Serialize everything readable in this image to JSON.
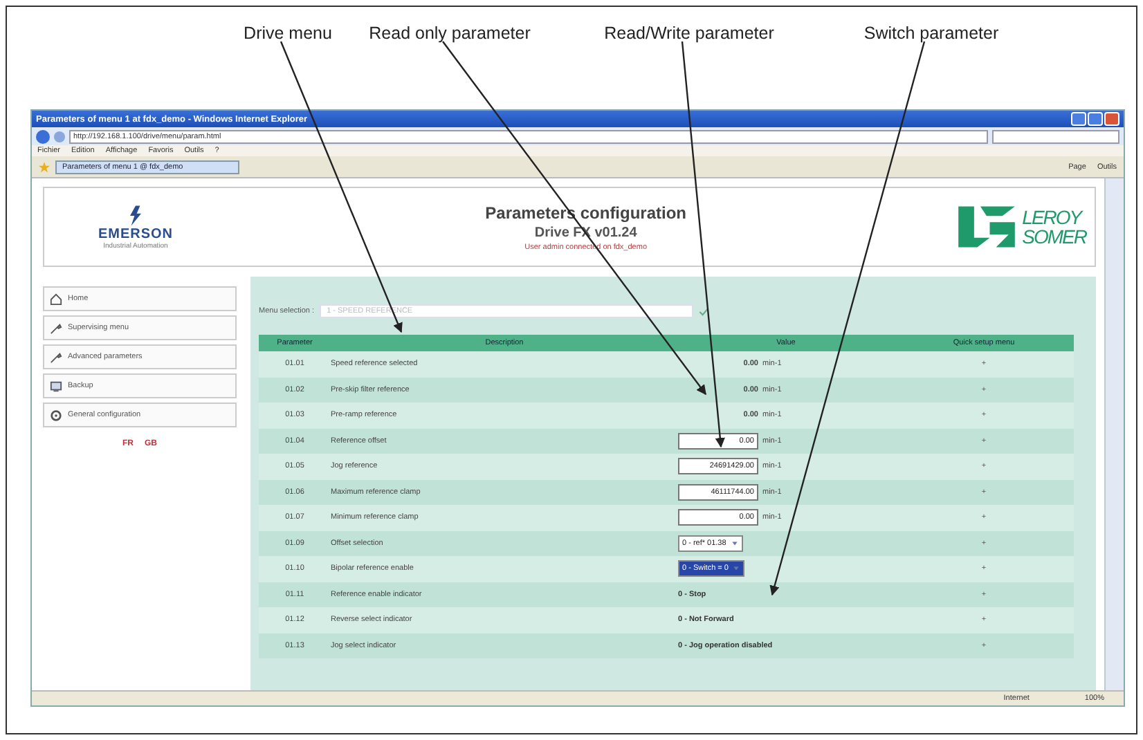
{
  "callouts": [
    "Drive menu",
    "Read only parameter",
    "Read/Write parameter",
    "Switch parameter"
  ],
  "browser": {
    "title": "Parameters of menu 1 at fdx_demo - Windows Internet Explorer",
    "address": "http://192.168.1.100/drive/menu/param.html",
    "menu": [
      "Fichier",
      "Edition",
      "Affichage",
      "Favoris",
      "Outils",
      "?"
    ],
    "tab": "Parameters of menu 1 @ fdx_demo",
    "tools": [
      "Page",
      "Outils"
    ],
    "status": [
      "Internet",
      "100%"
    ]
  },
  "header": {
    "brand_left": "EMERSON",
    "brand_left_sub": "Industrial Automation",
    "title": "Parameters configuration",
    "subtitle": "Drive FX v01.24",
    "user": "User admin connected on fdx_demo",
    "brand_right": [
      "LEROY",
      "SOMER"
    ]
  },
  "sidebar": [
    {
      "label": "Home"
    },
    {
      "label": "Supervising menu"
    },
    {
      "label": "Advanced parameters"
    },
    {
      "label": "Backup"
    },
    {
      "label": "General configuration"
    }
  ],
  "languages": [
    "FR",
    "GB"
  ],
  "menu_selection": {
    "label": "Menu selection :",
    "value": "1 - SPEED REFERENCE"
  },
  "table": {
    "columns": [
      "Parameter",
      "Description",
      "Value",
      "Quick setup menu"
    ],
    "rows": [
      {
        "param": "01.01",
        "description": "Speed reference selected",
        "kind": "readonly",
        "value": "0.00",
        "unit": "min-1",
        "quick": "+"
      },
      {
        "param": "01.02",
        "description": "Pre-skip filter reference",
        "kind": "readonly",
        "value": "0.00",
        "unit": "min-1",
        "quick": "+"
      },
      {
        "param": "01.03",
        "description": "Pre-ramp reference",
        "kind": "readonly",
        "value": "0.00",
        "unit": "min-1",
        "quick": "+"
      },
      {
        "param": "01.04",
        "description": "Reference offset",
        "kind": "input",
        "value": "0.00",
        "unit": "min-1",
        "quick": "+"
      },
      {
        "param": "01.05",
        "description": "Jog reference",
        "kind": "input",
        "value": "24691429.00",
        "unit": "min-1",
        "quick": "+"
      },
      {
        "param": "01.06",
        "description": "Maximum reference clamp",
        "kind": "input",
        "value": "46111744.00",
        "unit": "min-1",
        "quick": "+"
      },
      {
        "param": "01.07",
        "description": "Minimum reference clamp",
        "kind": "input",
        "value": "0.00",
        "unit": "min-1",
        "quick": "+"
      },
      {
        "param": "01.09",
        "description": "Offset selection",
        "kind": "select",
        "value": "0 - ref* 01.38",
        "selected": false,
        "quick": "+"
      },
      {
        "param": "01.10",
        "description": "Bipolar reference enable",
        "kind": "select",
        "value": "0 - Switch = 0",
        "selected": true,
        "quick": "+"
      },
      {
        "param": "01.11",
        "description": "Reference enable indicator",
        "kind": "text",
        "value": "0 - Stop",
        "quick": "+"
      },
      {
        "param": "01.12",
        "description": "Reverse select indicator",
        "kind": "text",
        "value": "0 - Not Forward",
        "quick": "+"
      },
      {
        "param": "01.13",
        "description": "Jog select indicator",
        "kind": "text",
        "value": "0 - Jog operation disabled",
        "quick": "+"
      }
    ]
  }
}
